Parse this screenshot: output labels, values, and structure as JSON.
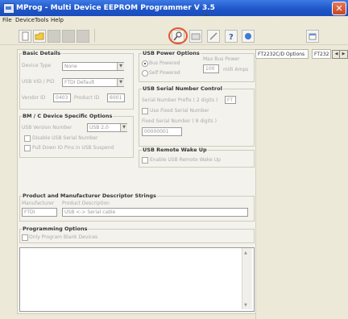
{
  "window": {
    "title": "MProg - Multi Device EEPROM Programmer V 3.5"
  },
  "menu": [
    "File",
    "Device",
    "Tools",
    "Help"
  ],
  "basic_details": {
    "title": "Basic Details",
    "device_type_label": "Device Type",
    "device_type_value": "None",
    "vid_pid_label": "USB VID / PID",
    "vid_pid_value": "FTDI Default",
    "vendor_id_label": "Vendor ID",
    "vendor_id_value": "0403",
    "product_id_label": "Product ID",
    "product_id_value": "6001"
  },
  "bm_c_options": {
    "title": "BM / C Device Specific Options",
    "usb_version_label": "USB Version Number",
    "usb_version_value": "USB 2.0",
    "disable_serial_label": "Disable USB Serial Number",
    "pull_down_label": "Pull Down IO Pins in USB Suspend"
  },
  "usb_power": {
    "title": "USB Power Options",
    "bus_powered": "Bus Powered",
    "self_powered": "Self Powered",
    "max_bus_power_label": "Max Bus Power",
    "max_bus_power_value": "100",
    "milli_amps": "milli Amps"
  },
  "usb_serial": {
    "title": "USB Serial Number Control",
    "prefix_label": "Serial Number Prefix ( 2 digits )",
    "prefix_value": "FT",
    "use_fixed_label": "Use Fixed Serial Number",
    "fixed_label": "Fixed Serial Number ( 8 digits )",
    "fixed_value": "00000001"
  },
  "usb_wake": {
    "title": "USB Remote Wake Up",
    "enable_label": "Enable USB Remote Wake Up"
  },
  "descriptor": {
    "title": "Product and Manufacturer Descriptor Strings",
    "manufacturer_label": "Manufacturer",
    "manufacturer_value": "FTDI",
    "description_label": "Product Description",
    "description_value": "USB <-> Serial cable"
  },
  "programming": {
    "title": "Programming Options",
    "only_blank_label": "Only Program Blank Devices"
  },
  "tabs": [
    "FT2232C/D Options",
    "FT232"
  ],
  "colors": {
    "titlebar": "#1f56c9",
    "highlight_circle": "#e8542c",
    "face": "#ece9d8"
  },
  "icons": [
    "new-file-icon",
    "open-folder-icon",
    "save-icon",
    "program-icon",
    "erase-icon",
    "search-icon",
    "read-icon",
    "parse-icon",
    "help-icon",
    "about-icon",
    "copy-icon"
  ]
}
